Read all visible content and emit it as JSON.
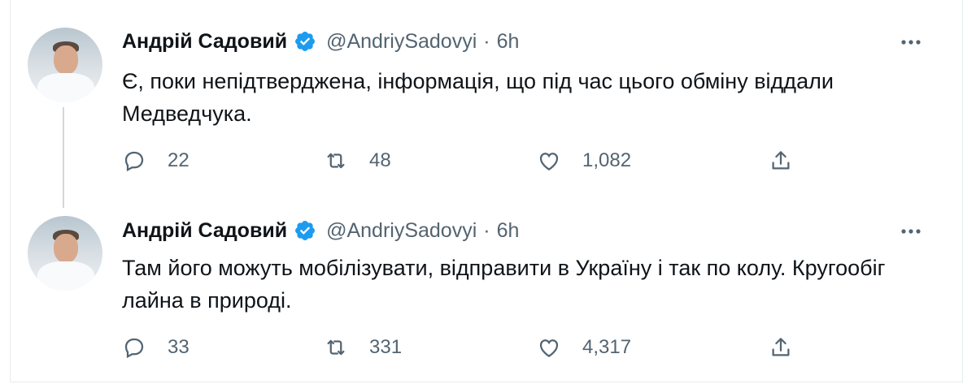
{
  "tweets": [
    {
      "author_name": "Андрій Садовий",
      "handle": "@AndriySadovyi",
      "separator": "·",
      "time": "6h",
      "text": "Є, поки непідтверджена, інформація, що під час цього обміну віддали Медведчука.",
      "replies": "22",
      "retweets": "48",
      "likes": "1,082"
    },
    {
      "author_name": "Андрій Садовий",
      "handle": "@AndriySadovyi",
      "separator": "·",
      "time": "6h",
      "text": "Там його можуть мобілізувати, відправити в Україну і так по колу. Кругообіг лайна в природі.",
      "replies": "33",
      "retweets": "331",
      "likes": "4,317"
    }
  ],
  "icons": {
    "verified": "verified-badge-icon",
    "more": "more-options-icon",
    "reply": "reply-icon",
    "retweet": "retweet-icon",
    "like": "heart-icon",
    "share": "share-icon"
  },
  "colors": {
    "verified": "#1d9bf0",
    "text": "#0f1419",
    "secondary": "#536471",
    "thread_line": "#cfd9de"
  }
}
